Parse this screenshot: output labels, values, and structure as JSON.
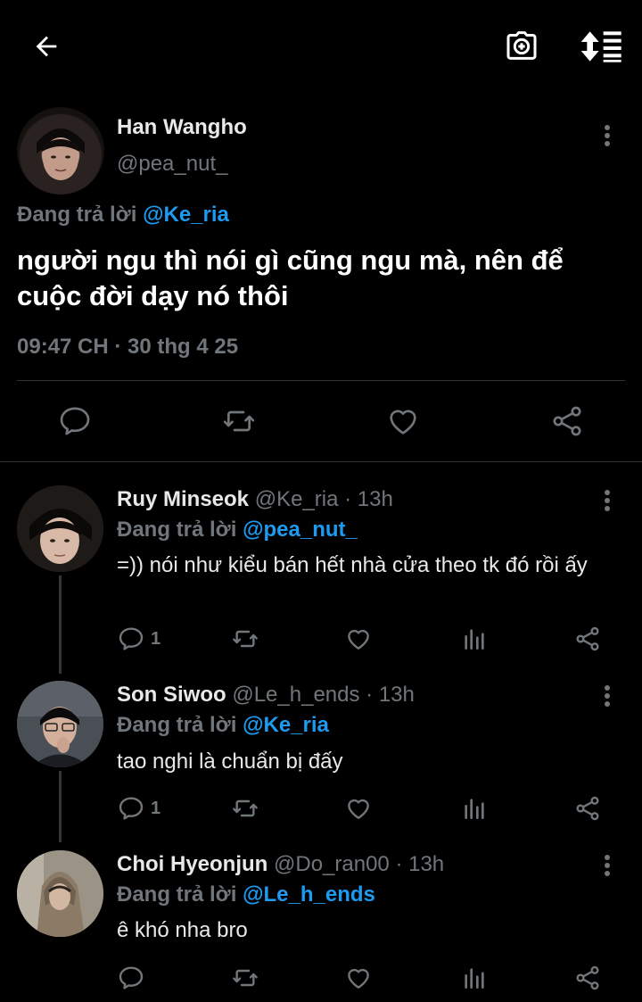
{
  "main_tweet": {
    "name": "Han Wangho",
    "handle": "@pea_nut_",
    "replying_prefix": "Đang trả lời",
    "replying_to": "@Ke_ria",
    "text": "người ngu thì nói gì cũng ngu mà, nên để cuộc đời dạy nó thôi",
    "meta": "09:47 CH · 30 thg 4 25"
  },
  "replies": [
    {
      "name": "Ruy Minseok",
      "handle_time": "@Ke_ria · 13h",
      "replying_prefix": "Đang trả lời",
      "replying_to": "@pea_nut_",
      "text": "=)) nói như kiểu bán hết nhà cửa theo tk đó rồi ấy",
      "reply_count": "1"
    },
    {
      "name": "Son Siwoo",
      "handle_time": "@Le_h_ends · 13h",
      "replying_prefix": "Đang trả lời",
      "replying_to": "@Ke_ria",
      "text": "tao nghi là chuẩn bị đấy",
      "reply_count": "1"
    },
    {
      "name": "Choi Hyeonjun",
      "handle_time": "@Do_ran00 · 13h",
      "replying_prefix": "Đang trả lời",
      "replying_to": "@Le_h_ends",
      "text": "ê khó nha bro",
      "reply_count": ""
    }
  ],
  "icons": {
    "back": "arrow-left-icon",
    "camera": "camera-plus-icon",
    "sort": "sort-icon",
    "more": "more-vertical-icon",
    "reply": "reply-icon",
    "retweet": "retweet-icon",
    "like": "heart-icon",
    "views": "views-icon",
    "share": "share-icon"
  },
  "colors": {
    "background": "#000000",
    "text": "#e7e9ea",
    "muted": "#71767b",
    "link": "#1d9bf0",
    "divider": "#2f3336"
  }
}
